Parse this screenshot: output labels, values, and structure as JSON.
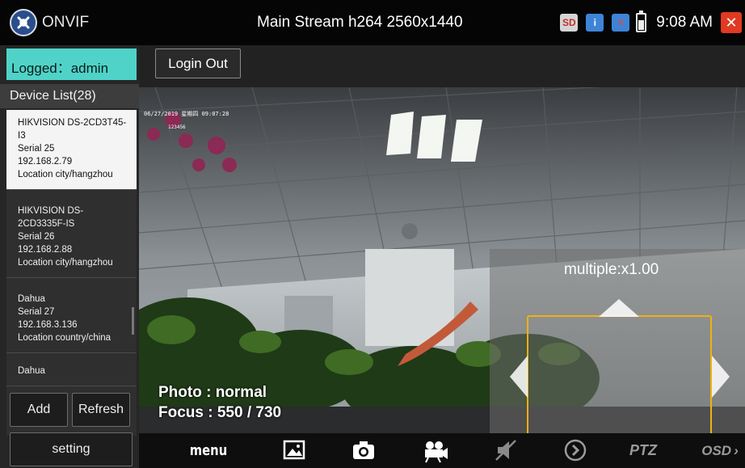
{
  "app": {
    "name": "ONVIF",
    "stream_title": "Main Stream h264 2560x1440",
    "clock": "9:08 AM",
    "status_icons": [
      "sd-card-icon",
      "info-icon",
      "network-icon",
      "battery-icon",
      "close-icon"
    ],
    "accent_color": "#4fd3c8"
  },
  "sidebar": {
    "logged_in": "Logged：admin",
    "device_list_title": "Device List(28)",
    "devices": [
      {
        "brand_model": "HIKVISION DS-2CD3T45-I3",
        "serial": "Serial 25",
        "ip": "192.168.2.79",
        "location": "Location city/hangzhou",
        "selected": true
      },
      {
        "brand_model": "HIKVISION DS-2CD3335F-IS",
        "serial": "Serial 26",
        "ip": "192.168.2.88",
        "location": "Location city/hangzhou",
        "selected": false
      },
      {
        "brand_model": "Dahua",
        "serial": "Serial 27",
        "ip": "192.168.3.136",
        "location": "Location country/china",
        "selected": false
      },
      {
        "brand_model": "Dahua",
        "serial": "",
        "ip": "",
        "location": "",
        "selected": false
      }
    ],
    "add_label": "Add",
    "refresh_label": "Refresh",
    "setting_label": "setting"
  },
  "toolbar": {
    "login_out_label": "Login Out"
  },
  "video": {
    "osd_timestamp": "06/27/2019 星期四 09:07:28",
    "osd_small": "123456",
    "photo_mode": "Photo : normal",
    "focus": "Focus : 550 / 730"
  },
  "ptz": {
    "multiple": "multiple:x1.00"
  },
  "bottombar": {
    "menu_label": "menu",
    "ptz_label": "PTZ",
    "osd_label": "OSD",
    "icons": [
      "gallery-icon",
      "camera-icon",
      "video-record-icon",
      "mute-icon",
      "play-icon"
    ]
  }
}
